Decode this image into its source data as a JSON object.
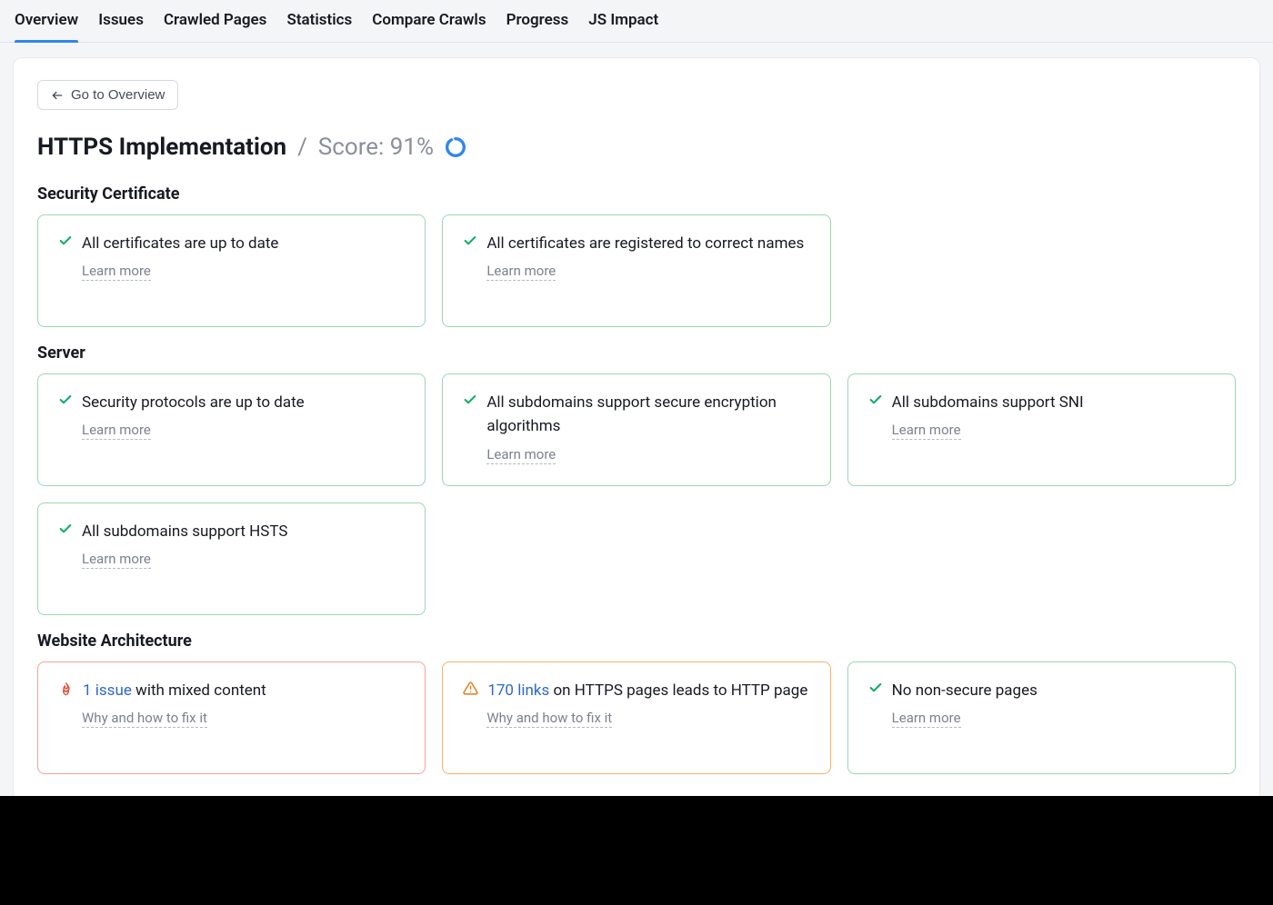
{
  "tabs": [
    {
      "label": "Overview",
      "active": true
    },
    {
      "label": "Issues"
    },
    {
      "label": "Crawled Pages"
    },
    {
      "label": "Statistics"
    },
    {
      "label": "Compare Crawls"
    },
    {
      "label": "Progress"
    },
    {
      "label": "JS Impact"
    }
  ],
  "back_button": "Go to Overview",
  "title": "HTTPS Implementation",
  "score_label": "Score: 91%",
  "score_pct": 91,
  "learn_more": "Learn more",
  "fix_it": "Why and how to fix it",
  "sections": [
    {
      "title": "Security Certificate",
      "cards": [
        {
          "status": "ok",
          "text": "All certificates are up to date",
          "help": "learn"
        },
        {
          "status": "ok",
          "text": "All certificates are registered to correct names",
          "help": "learn"
        },
        {
          "status": "empty"
        }
      ]
    },
    {
      "title": "Server",
      "cards": [
        {
          "status": "ok",
          "text": "Security protocols are up to date",
          "help": "learn"
        },
        {
          "status": "ok",
          "text": "All subdomains support secure encryption algorithms",
          "help": "learn"
        },
        {
          "status": "ok",
          "text": "All subdomains support SNI",
          "help": "learn"
        },
        {
          "status": "ok",
          "text": "All subdomains support HSTS",
          "help": "learn"
        },
        {
          "status": "empty"
        },
        {
          "status": "empty"
        }
      ]
    },
    {
      "title": "Website Architecture",
      "cards": [
        {
          "status": "error",
          "link": "1 issue",
          "text": " with mixed content",
          "help": "fix"
        },
        {
          "status": "warn",
          "link": "170 links",
          "text": " on HTTPS pages leads to HTTP page",
          "help": "fix"
        },
        {
          "status": "ok",
          "text": "No non-secure pages",
          "help": "learn"
        }
      ]
    }
  ],
  "colors": {
    "ok": "#0bab64",
    "error": "#e1513b",
    "warn": "#e07a16",
    "accent": "#2f86eb"
  }
}
